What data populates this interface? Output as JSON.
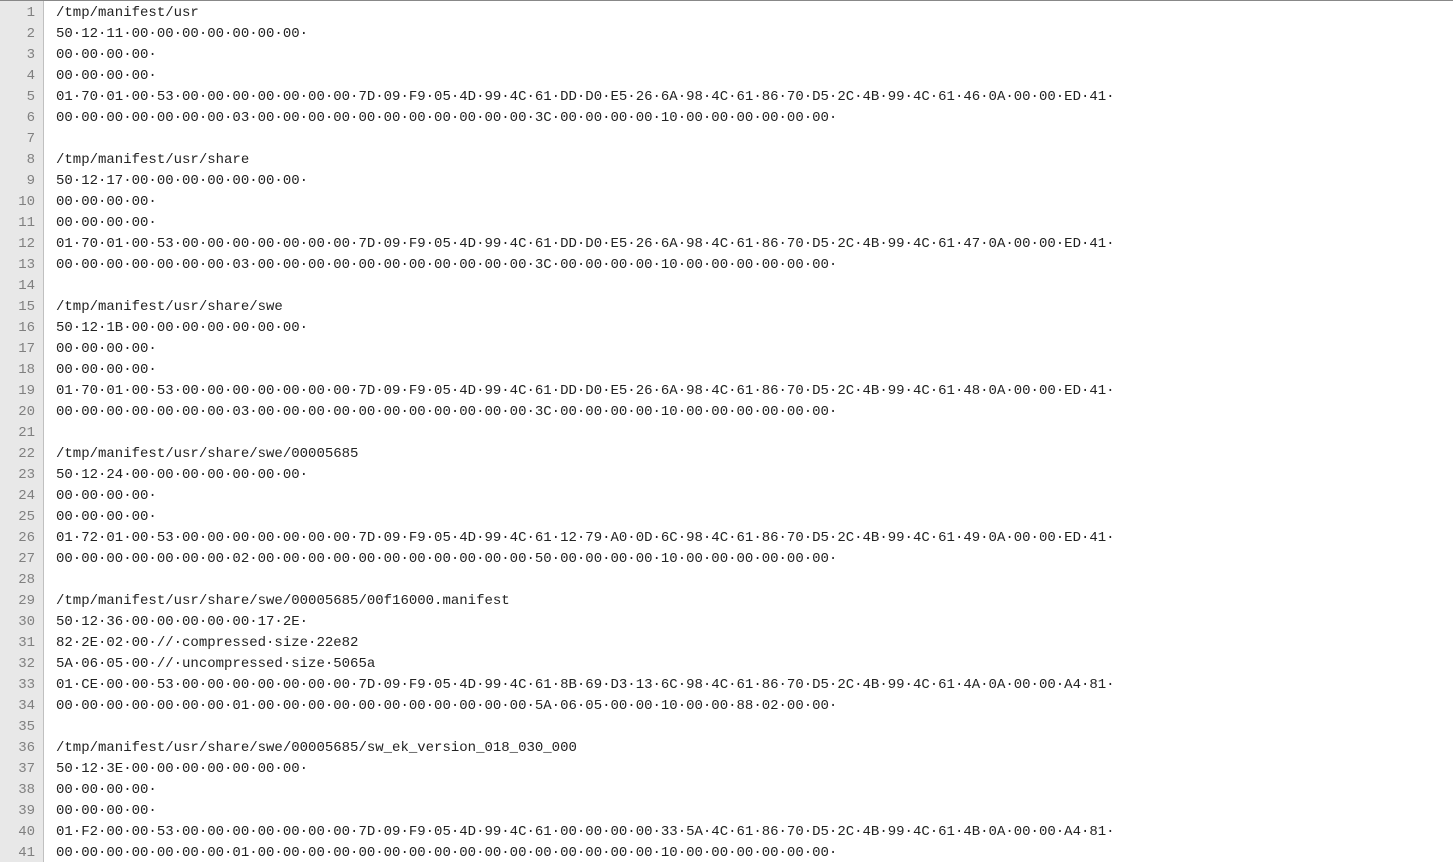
{
  "editor": {
    "lines": [
      "/tmp/manifest/usr",
      "50·12·11·00·00·00·00·00·00·00·",
      "00·00·00·00·",
      "00·00·00·00·",
      "01·70·01·00·53·00·00·00·00·00·00·00·7D·09·F9·05·4D·99·4C·61·DD·D0·E5·26·6A·98·4C·61·86·70·D5·2C·4B·99·4C·61·46·0A·00·00·ED·41·",
      "00·00·00·00·00·00·00·03·00·00·00·00·00·00·00·00·00·00·00·3C·00·00·00·00·10·00·00·00·00·00·00·",
      "",
      "/tmp/manifest/usr/share",
      "50·12·17·00·00·00·00·00·00·00·",
      "00·00·00·00·",
      "00·00·00·00·",
      "01·70·01·00·53·00·00·00·00·00·00·00·7D·09·F9·05·4D·99·4C·61·DD·D0·E5·26·6A·98·4C·61·86·70·D5·2C·4B·99·4C·61·47·0A·00·00·ED·41·",
      "00·00·00·00·00·00·00·03·00·00·00·00·00·00·00·00·00·00·00·3C·00·00·00·00·10·00·00·00·00·00·00·",
      "",
      "/tmp/manifest/usr/share/swe",
      "50·12·1B·00·00·00·00·00·00·00·",
      "00·00·00·00·",
      "00·00·00·00·",
      "01·70·01·00·53·00·00·00·00·00·00·00·7D·09·F9·05·4D·99·4C·61·DD·D0·E5·26·6A·98·4C·61·86·70·D5·2C·4B·99·4C·61·48·0A·00·00·ED·41·",
      "00·00·00·00·00·00·00·03·00·00·00·00·00·00·00·00·00·00·00·3C·00·00·00·00·10·00·00·00·00·00·00·",
      "",
      "/tmp/manifest/usr/share/swe/00005685",
      "50·12·24·00·00·00·00·00·00·00·",
      "00·00·00·00·",
      "00·00·00·00·",
      "01·72·01·00·53·00·00·00·00·00·00·00·7D·09·F9·05·4D·99·4C·61·12·79·A0·0D·6C·98·4C·61·86·70·D5·2C·4B·99·4C·61·49·0A·00·00·ED·41·",
      "00·00·00·00·00·00·00·02·00·00·00·00·00·00·00·00·00·00·00·50·00·00·00·00·10·00·00·00·00·00·00·",
      "",
      "/tmp/manifest/usr/share/swe/00005685/00f16000.manifest",
      "50·12·36·00·00·00·00·00·17·2E·",
      "82·2E·02·00·//·compressed·size·22e82",
      "5A·06·05·00·//·uncompressed·size·5065a",
      "01·CE·00·00·53·00·00·00·00·00·00·00·7D·09·F9·05·4D·99·4C·61·8B·69·D3·13·6C·98·4C·61·86·70·D5·2C·4B·99·4C·61·4A·0A·00·00·A4·81·",
      "00·00·00·00·00·00·00·01·00·00·00·00·00·00·00·00·00·00·00·5A·06·05·00·00·10·00·00·88·02·00·00·",
      "",
      "/tmp/manifest/usr/share/swe/00005685/sw_ek_version_018_030_000",
      "50·12·3E·00·00·00·00·00·00·00·",
      "00·00·00·00·",
      "00·00·00·00·",
      "01·F2·00·00·53·00·00·00·00·00·00·00·7D·09·F9·05·4D·99·4C·61·00·00·00·00·33·5A·4C·61·86·70·D5·2C·4B·99·4C·61·4B·0A·00·00·A4·81·",
      "00·00·00·00·00·00·00·01·00·00·00·00·00·00·00·00·00·00·00·00·00·00·00·00·10·00·00·00·00·00·00·"
    ]
  }
}
